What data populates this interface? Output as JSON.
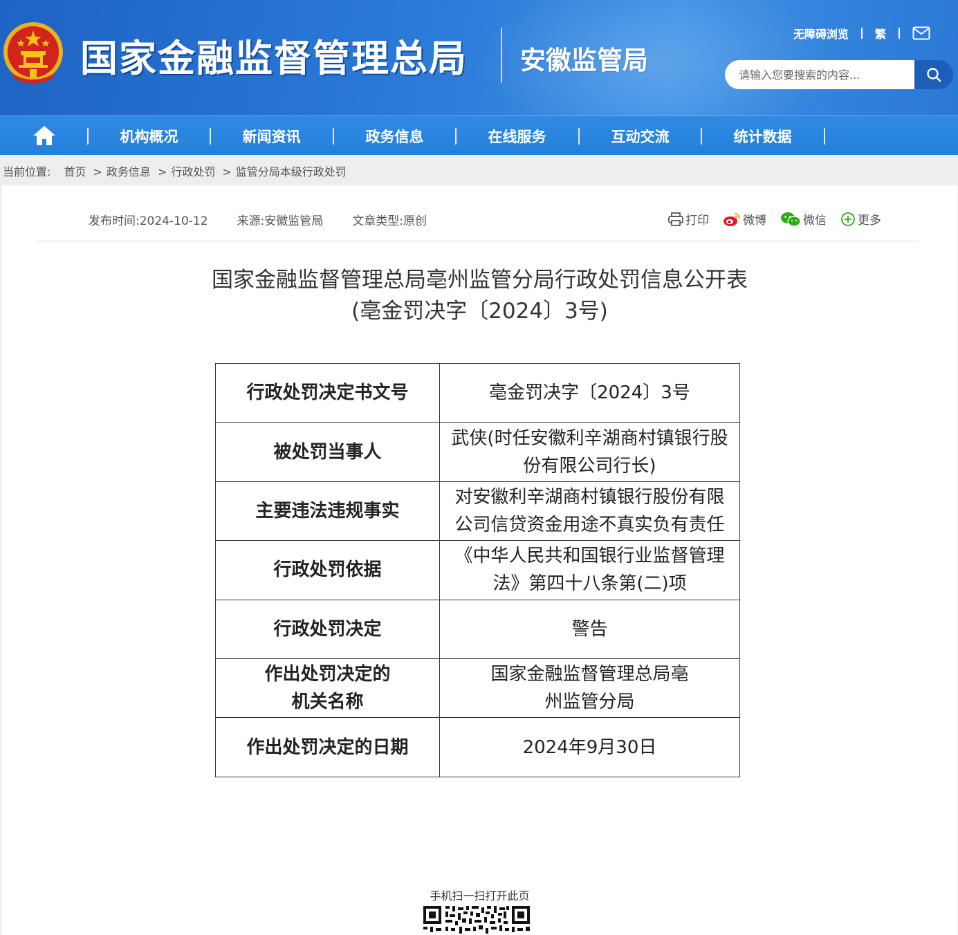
{
  "header": {
    "site_title": "国家金融监督管理总局",
    "sub_title": "安徽监管局",
    "links": {
      "accessible": "无障碍浏览",
      "traditional": "繁"
    },
    "search": {
      "placeholder": "请输入您要搜索的内容..."
    },
    "icons": {
      "emblem": "national-emblem-icon",
      "mail": "mail-icon",
      "search": "search-icon"
    },
    "colors": {
      "header_blue": "#2b7bd8",
      "nav_blue": "#2580da",
      "search_button": "#1d5fb8"
    }
  },
  "nav": {
    "items": [
      "机构概况",
      "新闻资讯",
      "政务信息",
      "在线服务",
      "互动交流",
      "统计数据"
    ]
  },
  "breadcrumb": {
    "label": "当前位置:",
    "items": [
      "首页",
      "政务信息",
      "行政处罚",
      "监管分局本级行政处罚"
    ],
    "separator": ">"
  },
  "article": {
    "meta": {
      "publish": "发布时间:2024-10-12",
      "source": "来源:安徽监管局",
      "type": "文章类型:原创"
    },
    "share": {
      "print": "打印",
      "weibo": "微博",
      "wechat": "微信",
      "more": "更多"
    },
    "title_line1": "国家金融监督管理总局亳州监管分局行政处罚信息公开表",
    "title_line2": "(亳金罚决字〔2024〕3号)",
    "table": [
      {
        "label": "行政处罚决定书文号",
        "value": "亳金罚决字〔2024〕3号"
      },
      {
        "label": "被处罚当事人",
        "value": "武侠(时任安徽利辛湖商村镇银行股份有限公司行长)"
      },
      {
        "label": "主要违法违规事实",
        "value": "对安徽利辛湖商村镇银行股份有限公司信贷资金用途不真实负有责任"
      },
      {
        "label": "行政处罚依据",
        "value": "《中华人民共和国银行业监督管理法》第四十八条第(二)项"
      },
      {
        "label": "行政处罚决定",
        "value": "警告"
      },
      {
        "label": "作出处罚决定的机关名称",
        "value": "国家金融监督管理总局亳州监管分局"
      },
      {
        "label": "作出处罚决定的日期",
        "value": "2024年9月30日"
      }
    ],
    "qr_label": "手机扫一扫打开此页"
  }
}
